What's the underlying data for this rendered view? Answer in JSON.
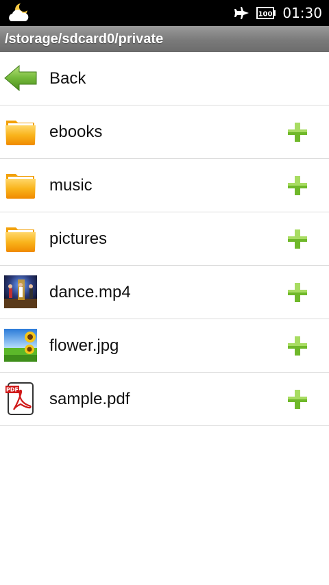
{
  "status_bar": {
    "time": "01:30",
    "battery_text": "100",
    "icons": [
      "weather-cloud-moon-icon",
      "airplane-mode-icon",
      "battery-icon"
    ]
  },
  "path_bar": {
    "path": "/storage/sdcard0/private"
  },
  "back_row": {
    "label": "Back",
    "icon": "back-arrow-icon"
  },
  "items": [
    {
      "label": "ebooks",
      "icon": "folder-icon"
    },
    {
      "label": "music",
      "icon": "folder-icon"
    },
    {
      "label": "pictures",
      "icon": "folder-icon"
    },
    {
      "label": "dance.mp4",
      "icon": "video-thumbnail-icon"
    },
    {
      "label": "flower.jpg",
      "icon": "image-thumbnail-icon"
    },
    {
      "label": "sample.pdf",
      "icon": "pdf-file-icon",
      "badge": "PDF"
    }
  ],
  "colors": {
    "folder": "#f7b015",
    "plus": "#6fb82a",
    "back_arrow": "#66b030",
    "path_bar": "#7a7a7a"
  }
}
